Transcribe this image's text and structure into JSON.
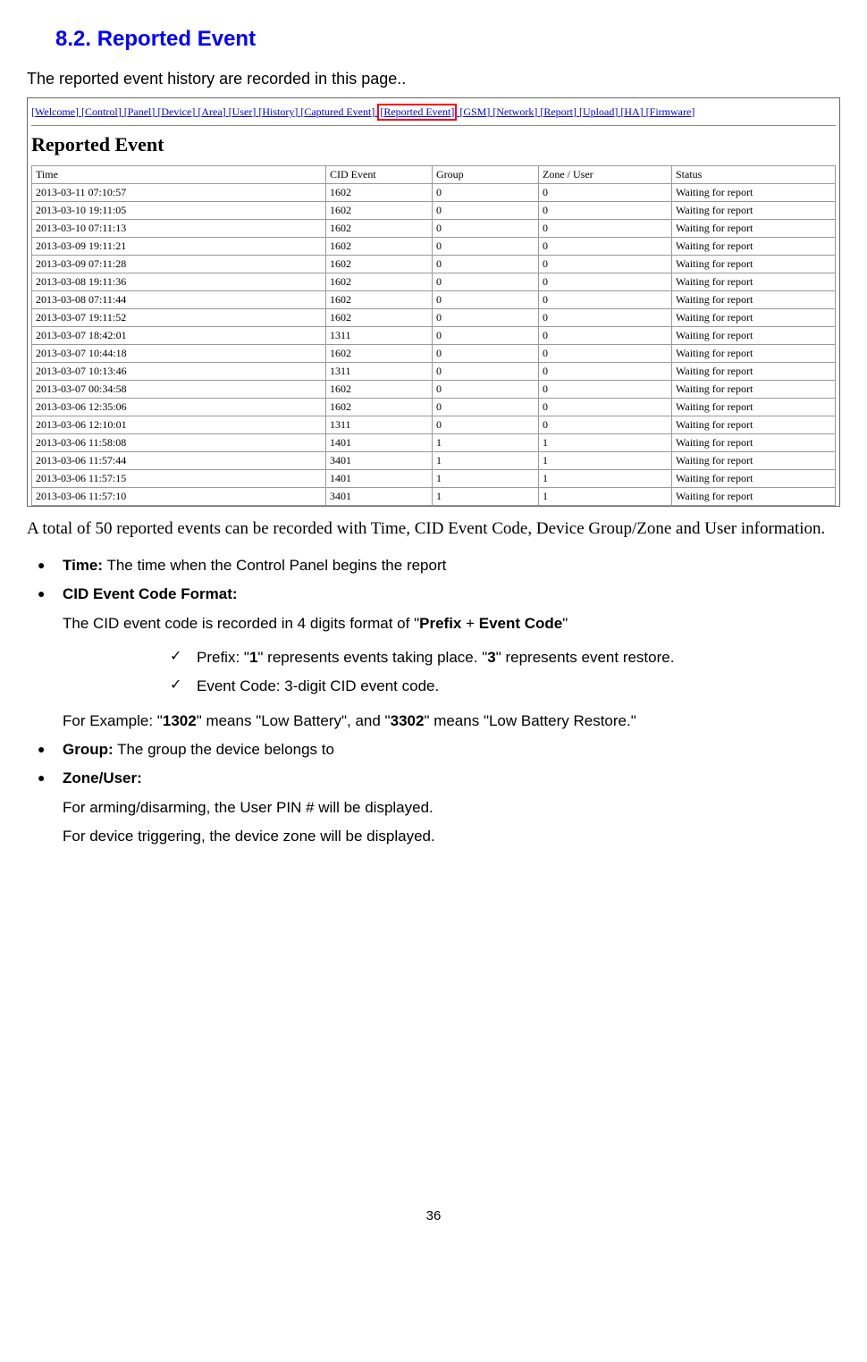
{
  "heading": "8.2. Reported Event",
  "intro": "The reported event history are recorded in this page..",
  "nav": [
    "Welcome",
    "Control",
    "Panel",
    "Device",
    "Area",
    "User",
    "History",
    "Captured Event",
    "Reported Event",
    "GSM",
    "Network",
    "Report",
    "Upload",
    "HA",
    "Firmware"
  ],
  "highlighted_nav": "Reported Event",
  "panel_title": "Reported Event",
  "columns": [
    "Time",
    "CID Event",
    "Group",
    "Zone / User",
    "Status"
  ],
  "rows": [
    {
      "time": "2013-03-11 07:10:57",
      "cid": "1602",
      "group": "0",
      "zone": "0",
      "status": "Waiting for report"
    },
    {
      "time": "2013-03-10 19:11:05",
      "cid": "1602",
      "group": "0",
      "zone": "0",
      "status": "Waiting for report"
    },
    {
      "time": "2013-03-10 07:11:13",
      "cid": "1602",
      "group": "0",
      "zone": "0",
      "status": "Waiting for report"
    },
    {
      "time": "2013-03-09 19:11:21",
      "cid": "1602",
      "group": "0",
      "zone": "0",
      "status": "Waiting for report"
    },
    {
      "time": "2013-03-09 07:11:28",
      "cid": "1602",
      "group": "0",
      "zone": "0",
      "status": "Waiting for report"
    },
    {
      "time": "2013-03-08 19:11:36",
      "cid": "1602",
      "group": "0",
      "zone": "0",
      "status": "Waiting for report"
    },
    {
      "time": "2013-03-08 07:11:44",
      "cid": "1602",
      "group": "0",
      "zone": "0",
      "status": "Waiting for report"
    },
    {
      "time": "2013-03-07 19:11:52",
      "cid": "1602",
      "group": "0",
      "zone": "0",
      "status": "Waiting for report"
    },
    {
      "time": "2013-03-07 18:42:01",
      "cid": "1311",
      "group": "0",
      "zone": "0",
      "status": "Waiting for report"
    },
    {
      "time": "2013-03-07 10:44:18",
      "cid": "1602",
      "group": "0",
      "zone": "0",
      "status": "Waiting for report"
    },
    {
      "time": "2013-03-07 10:13:46",
      "cid": "1311",
      "group": "0",
      "zone": "0",
      "status": "Waiting for report"
    },
    {
      "time": "2013-03-07 00:34:58",
      "cid": "1602",
      "group": "0",
      "zone": "0",
      "status": "Waiting for report"
    },
    {
      "time": "2013-03-06 12:35:06",
      "cid": "1602",
      "group": "0",
      "zone": "0",
      "status": "Waiting for report"
    },
    {
      "time": "2013-03-06 12:10:01",
      "cid": "1311",
      "group": "0",
      "zone": "0",
      "status": "Waiting for report"
    },
    {
      "time": "2013-03-06 11:58:08",
      "cid": "1401",
      "group": "1",
      "zone": "1",
      "status": "Waiting for report"
    },
    {
      "time": "2013-03-06 11:57:44",
      "cid": "3401",
      "group": "1",
      "zone": "1",
      "status": "Waiting for report"
    },
    {
      "time": "2013-03-06 11:57:15",
      "cid": "1401",
      "group": "1",
      "zone": "1",
      "status": "Waiting for report"
    },
    {
      "time": "2013-03-06 11:57:10",
      "cid": "3401",
      "group": "1",
      "zone": "1",
      "status": "Waiting for report"
    }
  ],
  "summary": "A total of 50 reported events can be recorded with Time, CID Event Code, Device Group/Zone and User information.",
  "bullets": {
    "time_label": "Time:",
    "time_desc": " The time when the Control Panel begins the report",
    "cid_label": "CID Event Code Format:",
    "cid_desc1_pre": "The CID event code is recorded in 4 digits format of \"",
    "cid_desc1_bold1": "Prefix",
    "cid_desc1_mid": " + ",
    "cid_desc1_bold2": "Event Code",
    "cid_desc1_post": "\"",
    "check1_pre": "Prefix: \"",
    "check1_b1": "1",
    "check1_mid": "\" represents events taking place. \"",
    "check1_b2": "3",
    "check1_post": "\" represents event restore.",
    "check2": "Event Code: 3-digit CID event code.",
    "example_pre": "For Example: \"",
    "example_b1": "1302",
    "example_mid1": "\" means \"Low Battery\", and \"",
    "example_b2": "3302",
    "example_post": "\" means \"Low Battery Restore.\"",
    "group_label": "Group:",
    "group_desc": " The group the device belongs to",
    "zone_label": "Zone/User:",
    "zone_desc1": "For arming/disarming, the User PIN # will be displayed.",
    "zone_desc2": "For device triggering, the device zone will be displayed."
  },
  "page_number": "36"
}
